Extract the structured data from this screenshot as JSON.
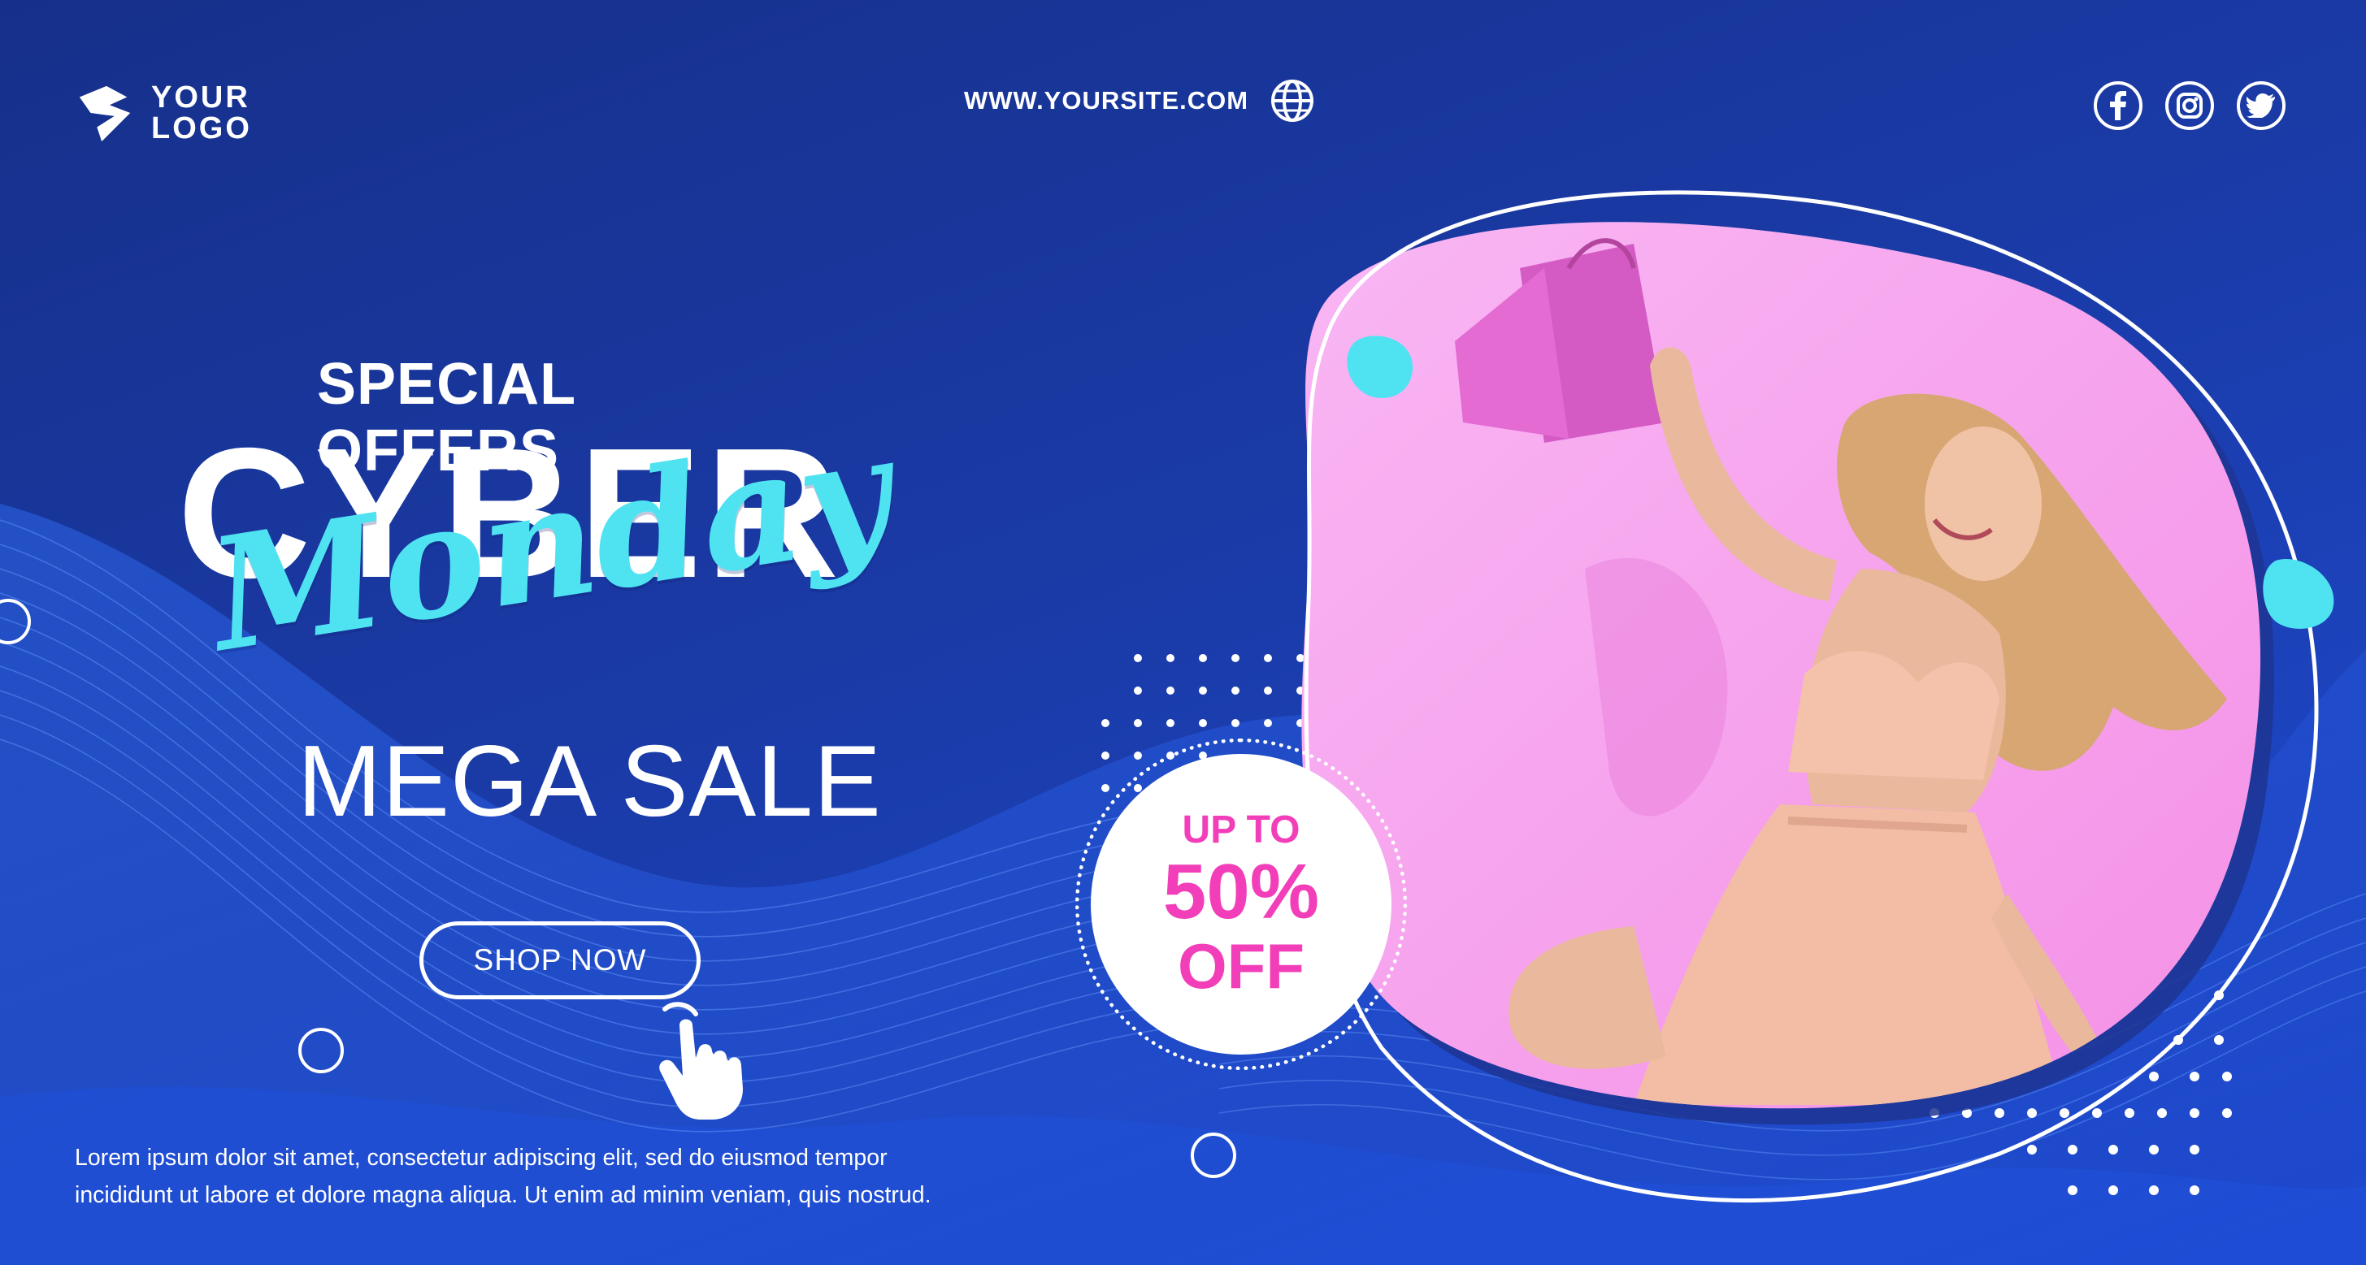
{
  "brand": {
    "logo_line1": "YOUR",
    "logo_line2": "LOGO"
  },
  "header": {
    "site_url": "WWW.YOURSITE.COM",
    "social": [
      "facebook-icon",
      "instagram-icon",
      "twitter-icon"
    ]
  },
  "headline": {
    "special": "SPECIAL OFFERS",
    "cyber": "CYBER",
    "monday": "Monday",
    "mega_sale": "MEGA SALE"
  },
  "cta": {
    "label": "SHOP NOW"
  },
  "discount": {
    "line1": "UP TO",
    "line2": "50%",
    "line3": "OFF"
  },
  "body_text": {
    "line1": "Lorem ipsum dolor sit amet, consectetur adipiscing elit, sed do eiusmod tempor",
    "line2": "incididunt ut labore et dolore magna aliqua. Ut enim ad minim veniam, quis nostrud."
  },
  "colors": {
    "background": "#1a3aa6",
    "accent_cyan": "#4fe3f2",
    "accent_pink": "#f23fb9",
    "photo_bg": "#f6a3ef"
  }
}
